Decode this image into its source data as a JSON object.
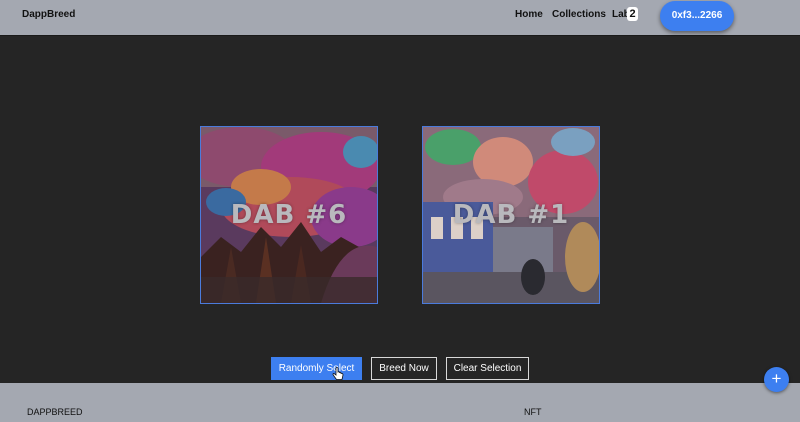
{
  "header": {
    "brand": "DappBreed",
    "nav": {
      "home": "Home",
      "collections": "Collections",
      "lab": "Lab",
      "lab_count": "2"
    },
    "wallet": "0xf3...2266"
  },
  "nfts": [
    {
      "label": "DAB #6"
    },
    {
      "label": "DAB #1"
    }
  ],
  "actions": {
    "random": "Randomly Select",
    "breed": "Breed Now",
    "clear": "Clear Selection"
  },
  "footer": {
    "left": "DAPPBREED",
    "right": "NFT"
  },
  "fab": "+",
  "colors": {
    "accent": "#3d7ff0",
    "header_bg": "#a4a8b1",
    "page_bg": "#252525"
  }
}
